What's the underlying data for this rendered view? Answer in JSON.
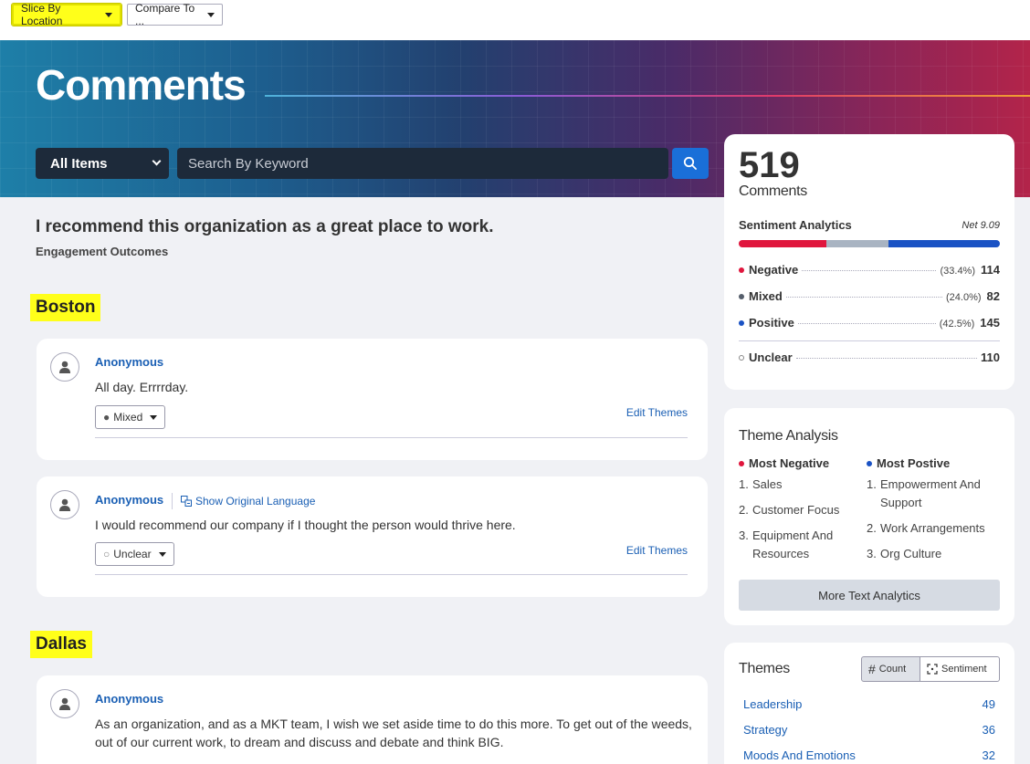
{
  "toolbar": {
    "slice_label": "Slice By Location",
    "compare_label": "Compare To ..."
  },
  "hero": {
    "title": "Comments",
    "filter_value": "All Items",
    "search_placeholder": "Search By Keyword"
  },
  "question": {
    "text": "I recommend this organization as a great place to work.",
    "category": "Engagement Outcomes"
  },
  "locations": [
    {
      "name": "Boston",
      "comments": [
        {
          "author": "Anonymous",
          "text": "All day. Errrrday.",
          "sentiment": "Mixed",
          "edit_label": "Edit Themes"
        },
        {
          "author": "Anonymous",
          "orig_language": "Show Original Language",
          "text": "I would recommend our company if I thought the person would thrive here.",
          "sentiment": "Unclear",
          "edit_label": "Edit Themes"
        }
      ]
    },
    {
      "name": "Dallas",
      "comments": [
        {
          "author": "Anonymous",
          "text": "As an organization, and as a MKT team, I wish we set aside time to do this more. To get out of the weeds, out of our current work, to dream and discuss and debate and think BIG."
        }
      ]
    }
  ],
  "summary": {
    "count": "519",
    "count_label": "Comments",
    "sentiment_title": "Sentiment Analytics",
    "net": "Net 9.09",
    "sentiments": [
      {
        "label": "Negative",
        "pct": "(33.4%)",
        "count": "114",
        "share": 33.4,
        "color": "#e0163d"
      },
      {
        "label": "Mixed",
        "pct": "(24.0%)",
        "count": "82",
        "share": 24.0,
        "color": "#a9b4c2"
      },
      {
        "label": "Positive",
        "pct": "(42.5%)",
        "count": "145",
        "share": 42.5,
        "color": "#1a52c4"
      }
    ],
    "unclear": {
      "label": "Unclear",
      "count": "110"
    }
  },
  "theme_analysis": {
    "title": "Theme Analysis",
    "negative_head": "Most Negative",
    "positive_head": "Most Postive",
    "negative": [
      "Sales",
      "Customer Focus",
      "Equipment And Resources"
    ],
    "positive": [
      "Empowerment And Support",
      "Work Arrangements",
      "Org Culture"
    ],
    "more_label": "More Text Analytics"
  },
  "themes": {
    "title": "Themes",
    "count_toggle": "Count",
    "sentiment_toggle": "Sentiment",
    "items": [
      {
        "name": "Leadership",
        "count": "49"
      },
      {
        "name": "Strategy",
        "count": "36"
      },
      {
        "name": "Moods And Emotions",
        "count": "32"
      }
    ]
  },
  "colors": {
    "accent": "#1a6fd8",
    "highlight": "#ffff1a",
    "negative": "#e0163d",
    "mixed": "#555e6b",
    "positive": "#1a52c4"
  }
}
